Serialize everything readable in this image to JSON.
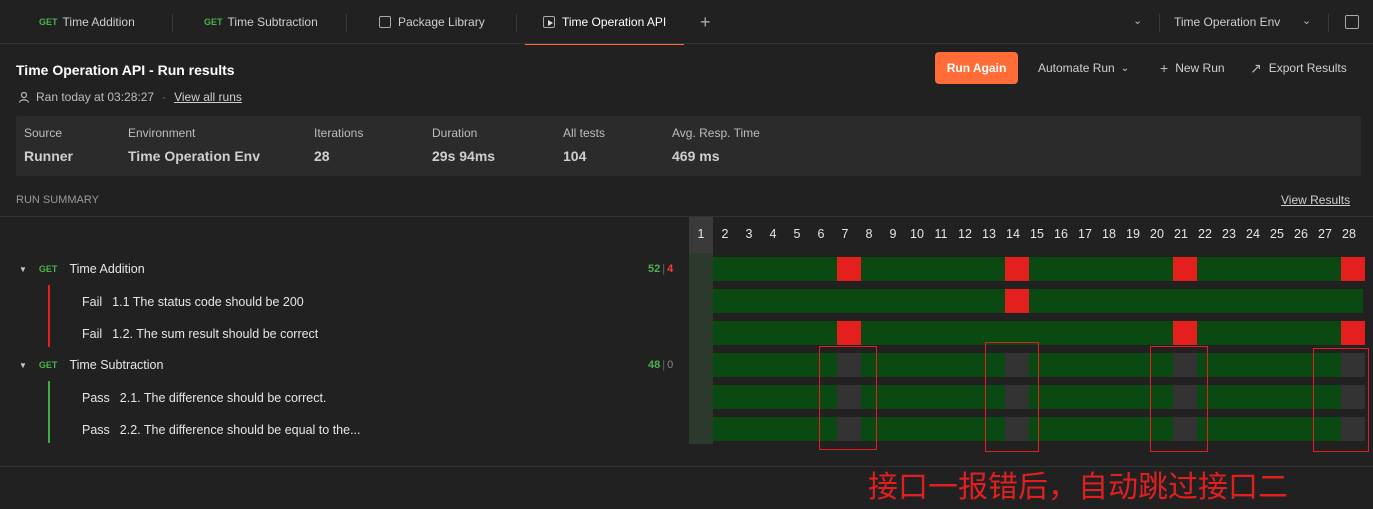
{
  "tabs": [
    {
      "method": "GET",
      "label": "Time Addition"
    },
    {
      "method": "GET",
      "label": "Time Subtraction"
    },
    {
      "icon": "package-icon",
      "label": "Package Library"
    },
    {
      "icon": "runner-icon",
      "label": "Time Operation API",
      "active": true
    }
  ],
  "env_selector": {
    "label": "Time Operation Env"
  },
  "header": {
    "title": "Time Operation API - Run results",
    "ran_text": "Ran today at 03:28:27",
    "view_all_runs": "View all runs",
    "run_again": "Run Again",
    "automate_run": "Automate Run",
    "new_run": "New Run",
    "export_results": "Export Results"
  },
  "stats": [
    {
      "label": "Source",
      "value": "Runner"
    },
    {
      "label": "Environment",
      "value": "Time Operation Env"
    },
    {
      "label": "Iterations",
      "value": "28"
    },
    {
      "label": "Duration",
      "value": "29s 94ms"
    },
    {
      "label": "All tests",
      "value": "104"
    },
    {
      "label": "Avg. Resp. Time",
      "value": "469 ms"
    }
  ],
  "summary": {
    "label": "RUN SUMMARY",
    "view_results": "View Results"
  },
  "requests": [
    {
      "method": "GET",
      "name": "Time Addition",
      "pass_count": "52",
      "fail_count": "4",
      "tests": [
        {
          "status": "Fail",
          "name": "1.1 The status code should be 200"
        },
        {
          "status": "Fail",
          "name": "1.2. The sum result should be correct"
        }
      ]
    },
    {
      "method": "GET",
      "name": "Time Subtraction",
      "pass_count": "48",
      "fail_count": "0",
      "tests": [
        {
          "status": "Pass",
          "name": "2.1. The difference should be correct."
        },
        {
          "status": "Pass",
          "name": "2.2. The difference should be equal to the..."
        }
      ]
    }
  ],
  "iterations": [
    "1",
    "2",
    "3",
    "4",
    "5",
    "6",
    "7",
    "8",
    "9",
    "10",
    "11",
    "12",
    "13",
    "14",
    "15",
    "16",
    "17",
    "18",
    "19",
    "20",
    "21",
    "22",
    "23",
    "24",
    "25",
    "26",
    "27",
    "28"
  ],
  "grid": {
    "failed_iterations_request1": [
      7,
      14,
      21,
      28
    ],
    "failed_iterations_test1_1": [
      14
    ],
    "failed_iterations_test1_2": [
      7,
      21,
      28
    ],
    "skipped_iterations_request2": [
      7,
      14,
      21,
      28
    ]
  },
  "colors": {
    "accent": "#ff6c37",
    "pass": "#4caf50",
    "fail": "#e51e1e",
    "pass_band": "#0a4a12",
    "annotation": "#e02020"
  },
  "annotation": "接口一报错后，自动跳过接口二"
}
